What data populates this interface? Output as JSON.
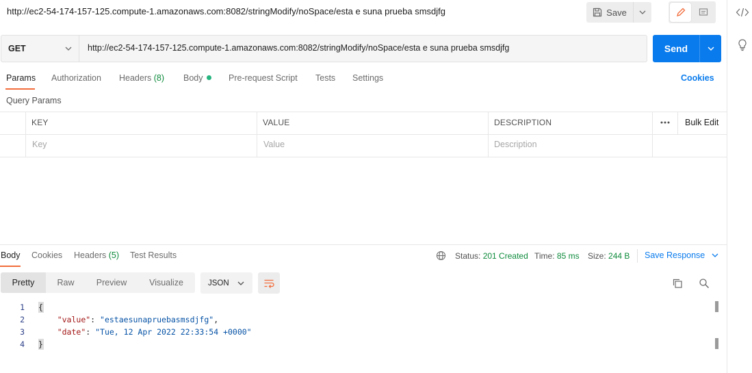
{
  "title": "http://ec2-54-174-157-125.compute-1.amazonaws.com:8082/stringModify/noSpace/esta e suna prueba smsdjfg",
  "toolbar": {
    "save_label": "Save"
  },
  "request": {
    "method": "GET",
    "url": "http://ec2-54-174-157-125.compute-1.amazonaws.com:8082/stringModify/noSpace/esta e suna prueba smsdjfg",
    "send_label": "Send"
  },
  "tabs": {
    "params": "Params",
    "authorization": "Authorization",
    "headers": "Headers",
    "headers_count": "(8)",
    "body": "Body",
    "prerequest": "Pre-request Script",
    "tests": "Tests",
    "settings": "Settings",
    "cookies": "Cookies"
  },
  "query_params": {
    "label": "Query Params",
    "columns": {
      "key": "KEY",
      "value": "VALUE",
      "description": "DESCRIPTION"
    },
    "bulk_edit": "Bulk Edit",
    "placeholders": {
      "key": "Key",
      "value": "Value",
      "description": "Description"
    }
  },
  "response": {
    "tabs": {
      "body": "Body",
      "cookies": "Cookies",
      "headers": "Headers",
      "headers_count": "(5)",
      "test_results": "Test Results"
    },
    "status_label": "Status:",
    "status_value": "201 Created",
    "time_label": "Time:",
    "time_value": "85 ms",
    "size_label": "Size:",
    "size_value": "244 B",
    "save_response": "Save Response",
    "formats": {
      "pretty": "Pretty",
      "raw": "Raw",
      "preview": "Preview",
      "visualize": "Visualize"
    },
    "language": "JSON",
    "code": {
      "line_numbers": [
        "1",
        "2",
        "3",
        "4"
      ],
      "open_brace": "{",
      "close_brace": "}",
      "key1": "\"value\"",
      "val1": "\"estaesunapruebasmsdjfg\"",
      "key2": "\"date\"",
      "val2": "\"Tue, 12 Apr 2022 22:33:54 +0000\""
    }
  },
  "colors": {
    "accent_blue": "#097bed",
    "tab_underline": "#f26b3a",
    "status_green": "#0c8a3a",
    "json_key": "#a31515",
    "json_string": "#0451a5"
  },
  "icons": [
    "save-icon",
    "chevron-down-icon",
    "pencil-icon",
    "comment-icon",
    "code-icon",
    "lightbulb-icon",
    "globe-icon",
    "more-horizontal-icon",
    "wrap-lines-icon",
    "copy-icon",
    "search-icon"
  ]
}
